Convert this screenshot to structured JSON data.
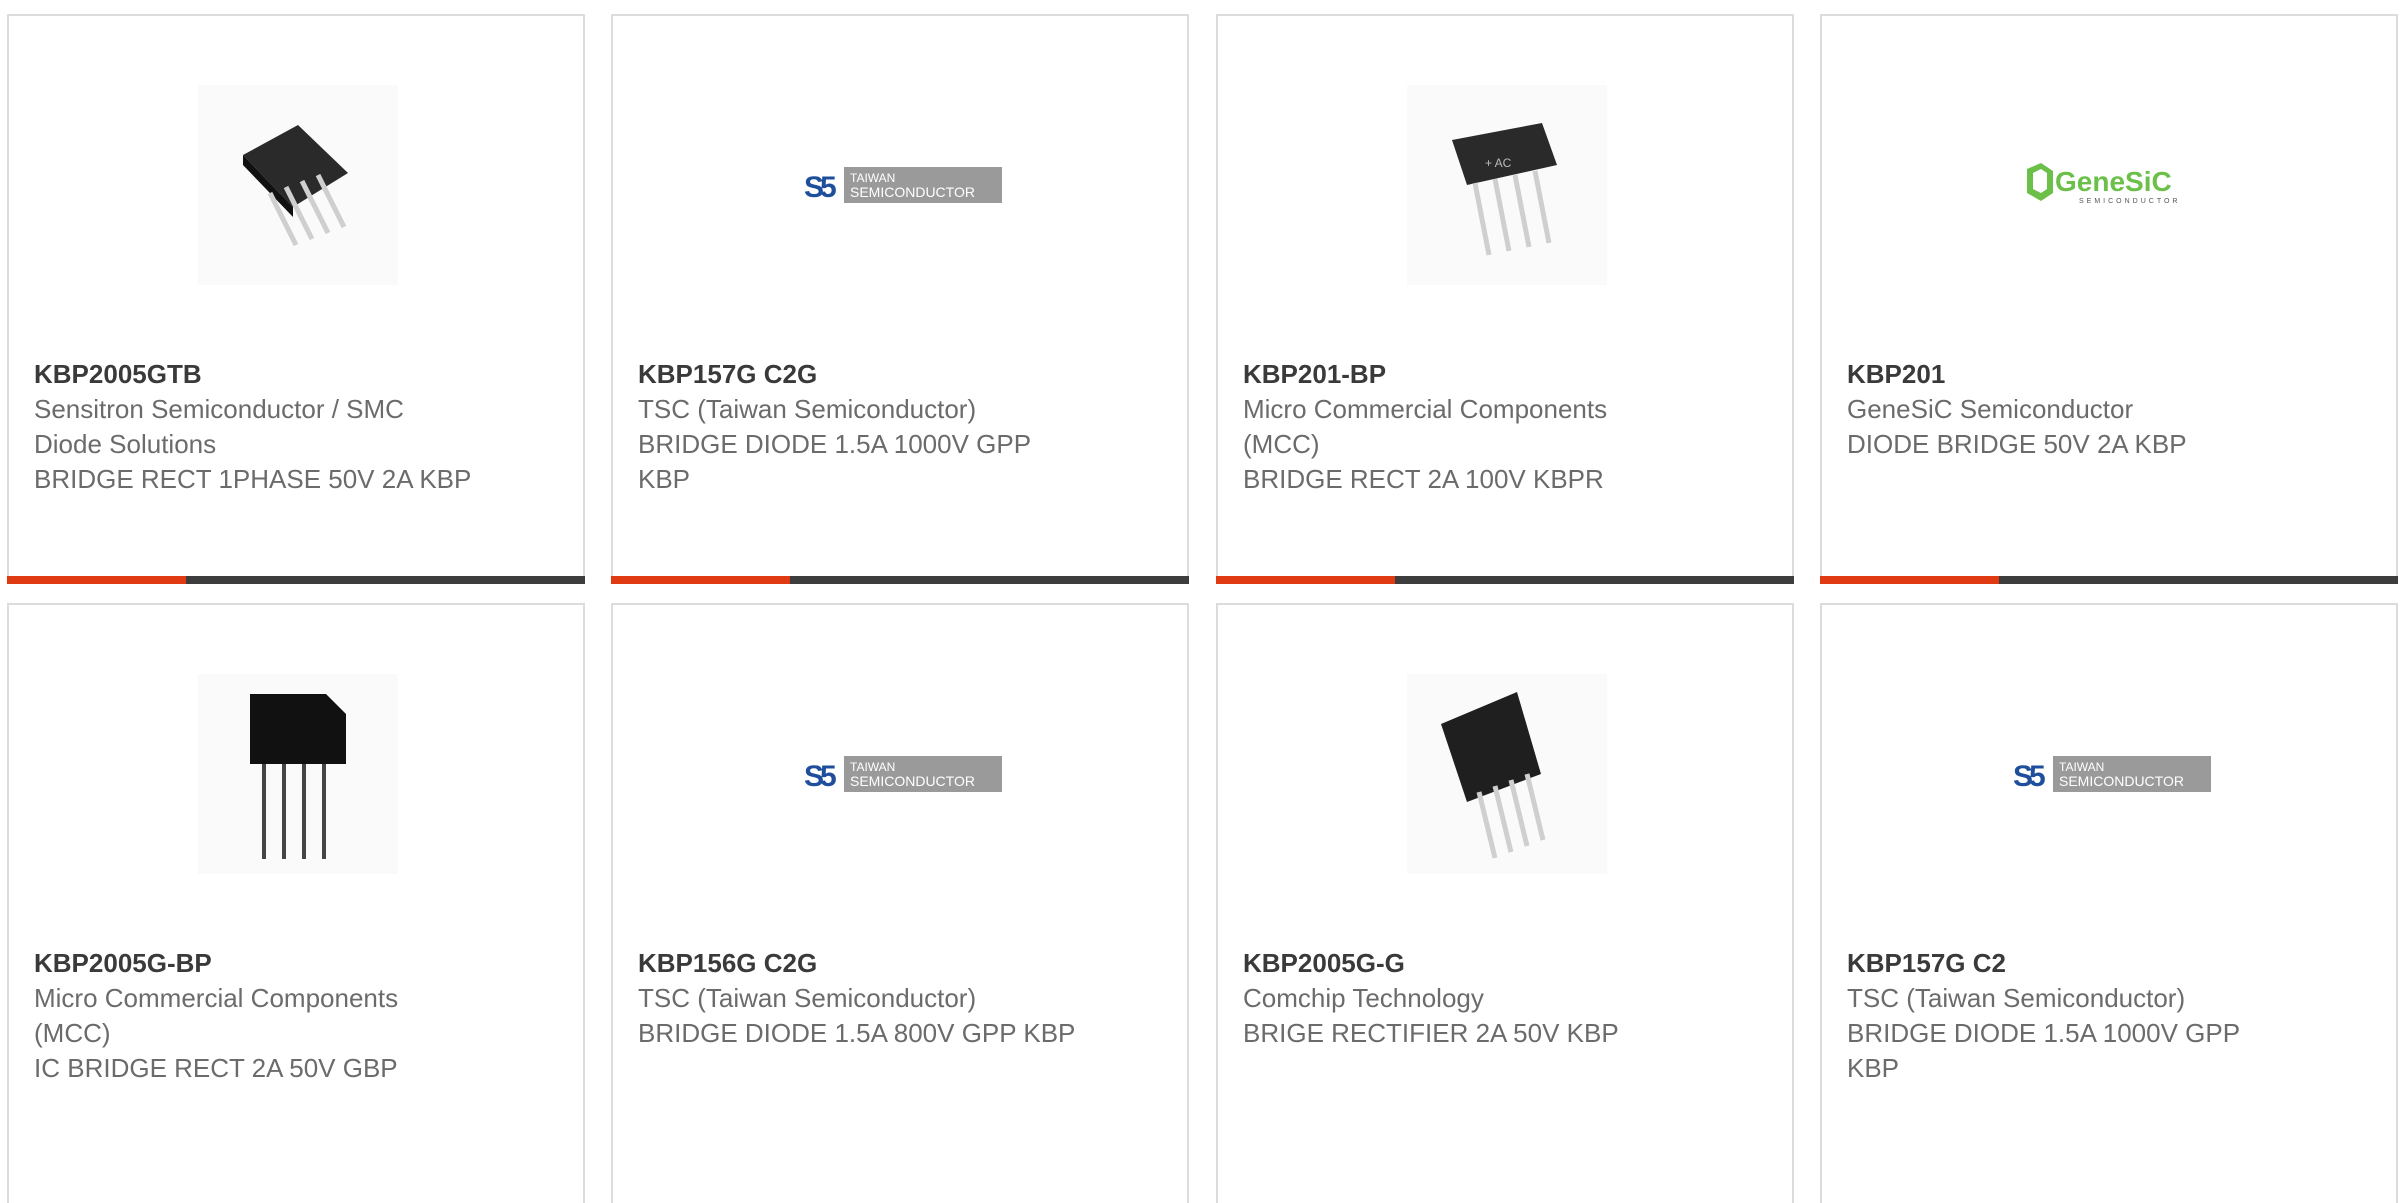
{
  "colors": {
    "accent": "#e03a12",
    "bar": "#3d3d3d",
    "border": "#dcdcdc",
    "part_text": "#3a3a3a",
    "body_text": "#6b6b6b"
  },
  "products": [
    {
      "part": "KBP2005GTB",
      "manufacturer": "Sensitron Semiconductor / SMC Diode Solutions",
      "description": "BRIDGE RECT 1PHASE 50V 2A KBP",
      "image": "bridge-rectifier-photo",
      "progress_fraction": 0.31
    },
    {
      "part": "KBP157G C2G",
      "manufacturer": "TSC (Taiwan Semiconductor)",
      "description": "BRIDGE DIODE 1.5A 1000V GPP KBP",
      "image": "taiwan-semiconductor-logo",
      "logo_text": [
        "TAIWAN",
        "SEMICONDUCTOR"
      ],
      "progress_fraction": 0.31
    },
    {
      "part": "KBP201-BP",
      "manufacturer": "Micro Commercial Components (MCC)",
      "description": "BRIDGE RECT 2A 100V KBPR",
      "image": "bridge-rectifier-photo",
      "progress_fraction": 0.31
    },
    {
      "part": "KBP201",
      "manufacturer": "GeneSiC Semiconductor",
      "description": "DIODE BRIDGE 50V 2A KBP",
      "image": "genesic-logo",
      "logo_text": [
        "GeneSiC",
        "SEMICONDUCTOR"
      ],
      "progress_fraction": 0.31
    },
    {
      "part": "KBP2005G-BP",
      "manufacturer": "Micro Commercial Components (MCC)",
      "description": "IC BRIDGE RECT 2A 50V GBP",
      "image": "bridge-rectifier-drawing"
    },
    {
      "part": "KBP156G C2G",
      "manufacturer": "TSC (Taiwan Semiconductor)",
      "description": "BRIDGE DIODE 1.5A 800V GPP KBP",
      "image": "taiwan-semiconductor-logo",
      "logo_text": [
        "TAIWAN",
        "SEMICONDUCTOR"
      ]
    },
    {
      "part": "KBP2005G-G",
      "manufacturer": "Comchip Technology",
      "description": "BRIGE RECTIFIER 2A 50V KBP",
      "image": "bridge-rectifier-photo"
    },
    {
      "part": "KBP157G C2",
      "manufacturer": "TSC (Taiwan Semiconductor)",
      "description": "BRIDGE DIODE 1.5A 1000V GPP KBP",
      "image": "taiwan-semiconductor-logo",
      "logo_text": [
        "TAIWAN",
        "SEMICONDUCTOR"
      ]
    }
  ]
}
